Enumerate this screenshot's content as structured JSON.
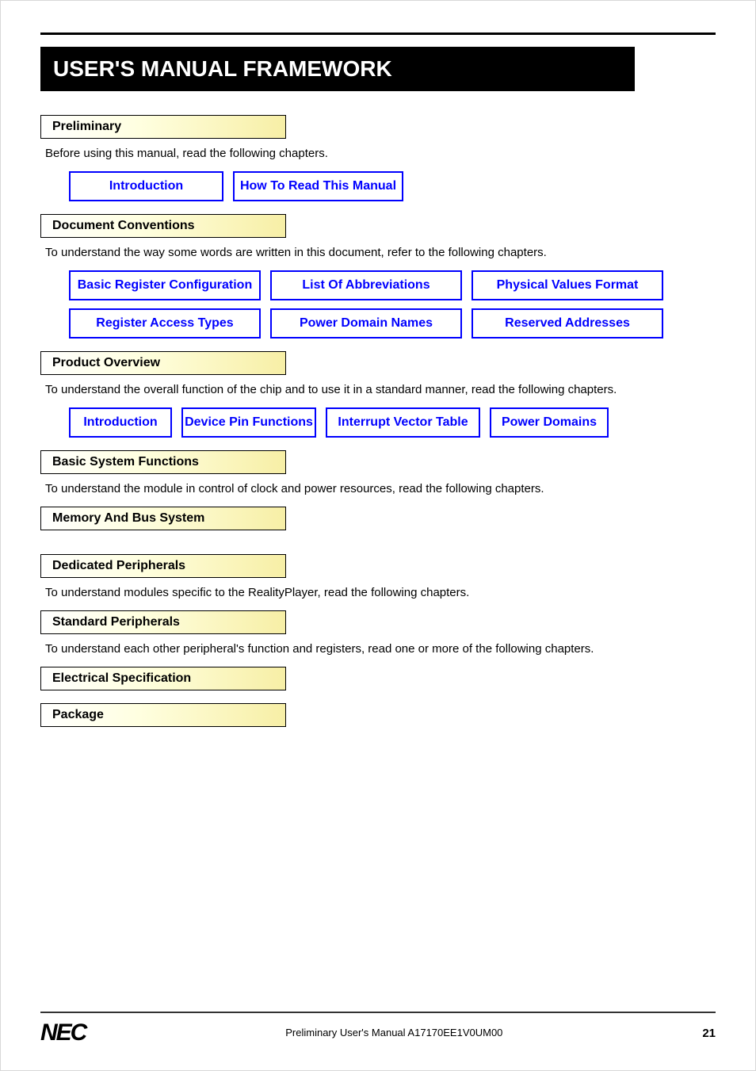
{
  "pageTitle": "USER'S MANUAL FRAMEWORK",
  "sections": [
    {
      "header": "Preliminary",
      "instruction": "Before using this manual, read the following chapters.",
      "rows": [
        [
          {
            "label": "Introduction",
            "w": "w-195"
          },
          {
            "label": "How To Read This Manual",
            "w": "w-215"
          }
        ]
      ]
    },
    {
      "header": "Document Conventions",
      "instruction": "To understand the way some words are written in this document, refer to the following chapters.",
      "rows": [
        [
          {
            "label": "Basic Register Configuration",
            "w": "w-242"
          },
          {
            "label": "List Of Abbreviations",
            "w": "w-242"
          },
          {
            "label": "Physical Values Format",
            "w": "w-242"
          }
        ],
        [
          {
            "label": "Register Access Types",
            "w": "w-242"
          },
          {
            "label": "Power Domain Names",
            "w": "w-242"
          },
          {
            "label": "Reserved Addresses",
            "w": "w-242"
          }
        ]
      ]
    },
    {
      "header": "Product Overview",
      "instruction": "To understand the overall function of the chip and to use it in a standard manner, read the following chapters.",
      "rows": [
        [
          {
            "label": "Introduction",
            "w": "w-130"
          },
          {
            "label": "Device Pin Functions",
            "w": "w-170"
          },
          {
            "label": "Interrupt Vector Table",
            "w": "w-195b"
          },
          {
            "label": "Power Domains",
            "w": "w-150"
          }
        ]
      ]
    },
    {
      "header": "Basic System Functions",
      "instruction": "To understand the module in control of clock and power resources, read the following chapters.",
      "rows": []
    },
    {
      "header": "Memory And Bus System",
      "rows": []
    },
    {
      "header": "Dedicated Peripherals",
      "instruction": "To understand modules specific to the RealityPlayer, read the following chapters.",
      "rows": []
    },
    {
      "header": "Standard Peripherals",
      "instruction": "To understand each other peripheral's function and registers, read one or more of the following chapters.",
      "rows": []
    },
    {
      "header": "Electrical Specification",
      "rows": []
    },
    {
      "header": "Package",
      "rows": []
    }
  ],
  "footer": {
    "logo": "NEC",
    "center": "Preliminary User's Manual A17170EE1V0UM00",
    "right": "21"
  }
}
